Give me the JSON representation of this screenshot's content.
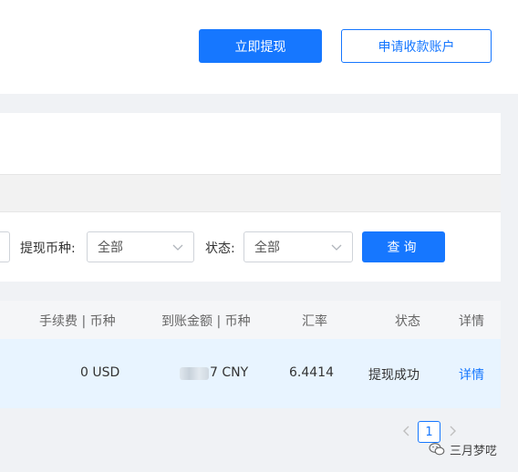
{
  "header": {
    "withdraw_now": "立即提现",
    "apply_account": "申请收款账户"
  },
  "filters": {
    "currency_label": "提现币种:",
    "currency_value": "全部",
    "status_label": "状态:",
    "status_value": "全部",
    "query_button": "查询"
  },
  "table": {
    "columns": [
      "手续费 | 币种",
      "到账金额 | 币种",
      "汇率",
      "状态",
      "详情"
    ],
    "rows": [
      {
        "fee": "0 USD",
        "received": "7 CNY",
        "rate": "6.4414",
        "status": "提现成功",
        "detail": "详情"
      }
    ]
  },
  "pagination": {
    "current": "1",
    "prev_icon": "chevron-left-icon",
    "next_icon": "chevron-right-icon"
  },
  "watermark": {
    "text": "三月梦呓",
    "icon": "wechat-icon"
  },
  "colors": {
    "primary": "#1677ff",
    "row_highlight": "#e8f4ff",
    "page_bg": "#f0f2f5"
  }
}
